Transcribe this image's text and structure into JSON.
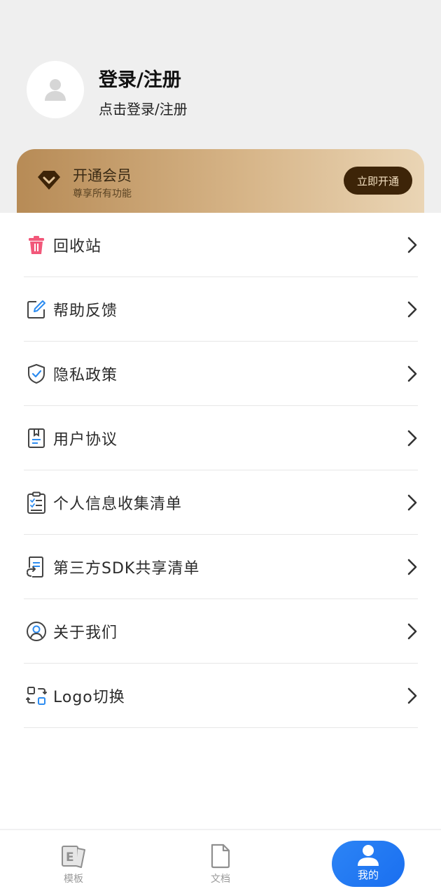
{
  "profile": {
    "title": "登录/注册",
    "subtitle": "点击登录/注册"
  },
  "vip": {
    "title": "开通会员",
    "subtitle": "尊享所有功能",
    "button": "立即开通"
  },
  "menu": [
    {
      "label": "回收站",
      "icon": "trash-icon"
    },
    {
      "label": "帮助反馈",
      "icon": "edit-icon"
    },
    {
      "label": "隐私政策",
      "icon": "shield-icon"
    },
    {
      "label": "用户协议",
      "icon": "document-icon"
    },
    {
      "label": "个人信息收集清单",
      "icon": "clipboard-icon"
    },
    {
      "label": "第三方SDK共享清单",
      "icon": "shared-list-icon"
    },
    {
      "label": "关于我们",
      "icon": "user-circle-icon"
    },
    {
      "label": "Logo切换",
      "icon": "switch-icon"
    }
  ],
  "tabs": [
    {
      "label": "模板",
      "icon": "template-icon",
      "active": false
    },
    {
      "label": "文档",
      "icon": "file-icon",
      "active": false
    },
    {
      "label": "我的",
      "icon": "user-icon",
      "active": true
    }
  ],
  "colors": {
    "accent": "#1a6ff0",
    "vip_button": "#3d2408",
    "trash": "#f2587a"
  }
}
